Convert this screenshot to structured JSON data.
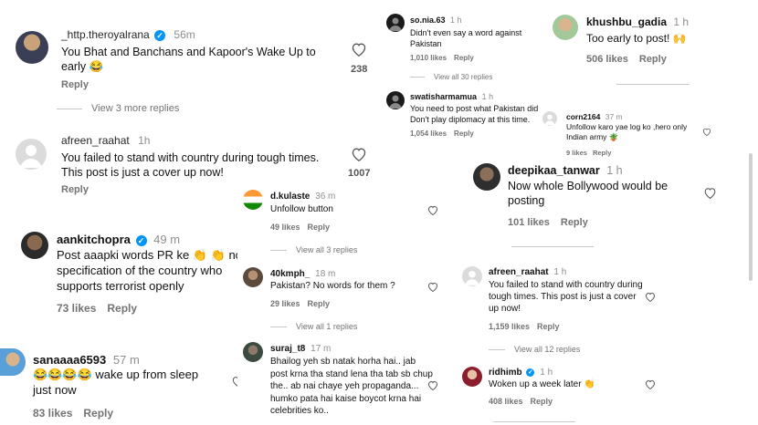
{
  "left": {
    "c1": {
      "user": "_http.theroyalrana",
      "time": "56m",
      "text": "You Bhat and Banchans and Kapoor's Wake Up to early 😂",
      "reply": "Reply",
      "heart_count": "238"
    },
    "c1_view": "View 3 more replies",
    "c2": {
      "user": "afreen_raahat",
      "time": "1h",
      "text": "You failed to stand with country during tough times. This post is just a cover up now!",
      "reply": "Reply",
      "heart_count": "1007"
    },
    "c3": {
      "user": "aankitchopra",
      "time": "49 m",
      "text": "Post aaapki words PR ke 👏 👏 no specification of the country who supports terrorist openly",
      "likes": "73 likes",
      "reply": "Reply"
    },
    "c4": {
      "user": "sanaaaa6593",
      "time": "57 m",
      "text": "😂😂😂😂 wake up from sleep just now",
      "likes": "83 likes",
      "reply": "Reply"
    }
  },
  "mid": {
    "c1": {
      "user": "d.kulaste",
      "time": "36 m",
      "text": "Unfollow button",
      "likes": "49 likes",
      "reply": "Reply"
    },
    "c1_view": "View all 3 replies",
    "c2": {
      "user": "40kmph_",
      "time": "18 m",
      "text": "Pakistan? No words for them ?",
      "likes": "29 likes",
      "reply": "Reply"
    },
    "c2_view": "View all 1 replies",
    "c3": {
      "user": "suraj_t8",
      "time": "17 m",
      "text": "Bhailog yeh sb natak horha hai.. jab post krna tha stand lena tha tab sb chup the.. ab nai chaye yeh propaganda... humko pata hai kaise boycot krna hai celebrities ko.."
    }
  },
  "right": {
    "c1": {
      "user": "so.nia.63",
      "time": "1 h",
      "text": "Didn't even say a word against Pakistan",
      "likes": "1,010 likes",
      "reply": "Reply"
    },
    "c1_view": "View all 30 replies",
    "c2": {
      "user": "khushbu_gadia",
      "time": "1 h",
      "text": "Too early to post! 🙌",
      "likes": "506 likes",
      "reply": "Reply"
    },
    "c3": {
      "user": "swatisharmamua",
      "time": "1 h",
      "text": "You need to post what Pakistan did. Don't play diplomacy at this time.",
      "likes": "1,054 likes",
      "reply": "Reply"
    },
    "c4": {
      "user": "corn2164",
      "time": "37 m",
      "text": "Unfollow karo yae log ko ,hero only Indian army 🪴",
      "likes": "9 likes",
      "reply": "Reply"
    },
    "c5": {
      "user": "deepikaa_tanwar",
      "time": "1 h",
      "text": "Now whole Bollywood would be posting",
      "likes": "101 likes",
      "reply": "Reply"
    },
    "c6": {
      "user": "afreen_raahat",
      "time": "1 h",
      "text": "You failed to stand with country during tough times. This post is just a cover up now!",
      "likes": "1,159 likes",
      "reply": "Reply"
    },
    "c6_view": "View all 12 replies",
    "c7": {
      "user": "ridhimb",
      "time": "1 h",
      "text": "Woken up a week later 👏",
      "likes": "408 likes",
      "reply": "Reply"
    }
  }
}
